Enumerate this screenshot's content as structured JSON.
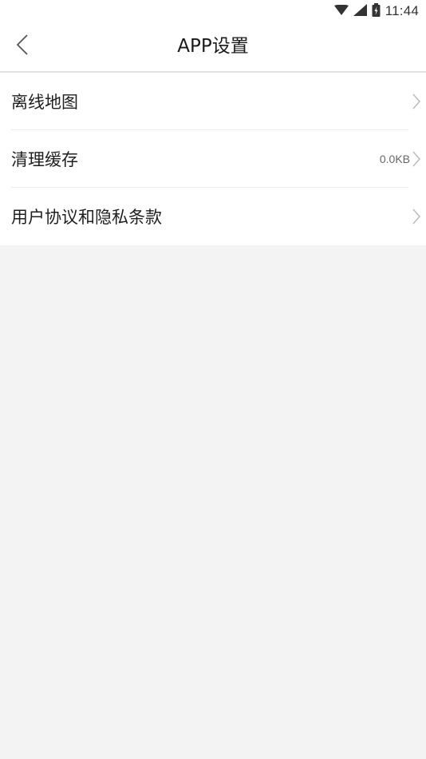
{
  "status_bar": {
    "time": "11:44",
    "icons": [
      "wifi-icon",
      "signal-icon",
      "battery-icon"
    ]
  },
  "header": {
    "back_icon": "chevron-left-icon",
    "title": "APP设置"
  },
  "settings": {
    "items": [
      {
        "label": "离线地图",
        "value": "",
        "icon": "chevron-right-icon"
      },
      {
        "label": "清理缓存",
        "value": "0.0KB",
        "icon": "chevron-right-icon"
      },
      {
        "label": "用户协议和隐私条款",
        "value": "",
        "icon": "chevron-right-icon"
      }
    ]
  },
  "colors": {
    "background": "#f3f3f3",
    "surface": "#ffffff",
    "divider": "#ececec",
    "text": "#1f1f1f",
    "secondary_text": "#666666",
    "chevron": "#b8b8b8"
  }
}
